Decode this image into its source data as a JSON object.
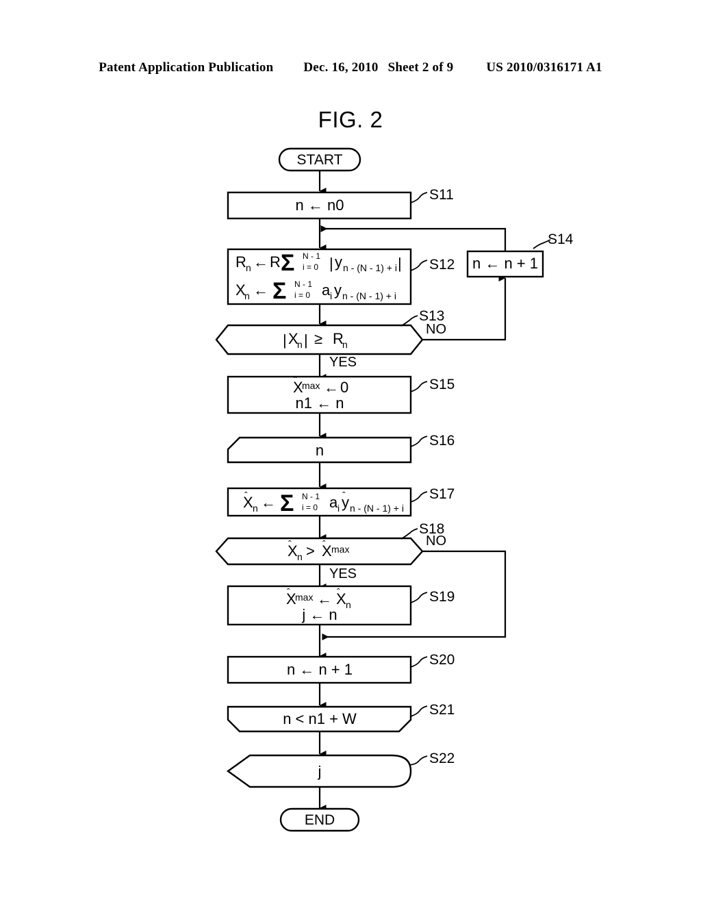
{
  "header": {
    "publication": "Patent Application Publication",
    "date": "Dec. 16, 2010",
    "sheet": "Sheet 2 of 9",
    "number": "US 2010/0316171 A1"
  },
  "figure": {
    "title": "FIG. 2"
  },
  "chart_data": {
    "type": "diagram",
    "diagram_kind": "flowchart",
    "title": "FIG. 2",
    "nodes": [
      {
        "id": "start",
        "shape": "terminator",
        "text": "START",
        "step": ""
      },
      {
        "id": "s11",
        "shape": "process",
        "text": "n ← n0",
        "step": "S11"
      },
      {
        "id": "s12",
        "shape": "process",
        "step": "S12",
        "line1": "Rₙ ← R Σ | yₙ₋₍ₙ₋₁₎₊ᵢ |",
        "line1_parts": {
          "lhs": "R",
          "lhs_sub": "n",
          "arrow": "←",
          "coef": "R",
          "sigma": "Σ",
          "upper": "N - 1",
          "lower": "i = 0",
          "body": "y",
          "body_sub": "n - (N - 1) + i"
        },
        "line2_parts": {
          "lhs": "X",
          "lhs_sub": "n",
          "arrow": "←",
          "sigma": "Σ",
          "upper": "N - 1",
          "lower": "i = 0",
          "coef": "a",
          "coef_sub": "i",
          "body": "y",
          "body_sub": "n - (N - 1) + i"
        }
      },
      {
        "id": "s13",
        "shape": "decision",
        "step": "S13",
        "text_parts": {
          "abs_open": "|",
          "x": "X",
          "x_sub": "n",
          "abs_close": "|",
          "op": "≥",
          "r": "R",
          "r_sub": "n"
        },
        "yes": "YES",
        "no": "NO"
      },
      {
        "id": "s14",
        "shape": "process",
        "text": "n ← n + 1",
        "step": "S14"
      },
      {
        "id": "s15",
        "shape": "process",
        "step": "S15",
        "line1_parts": {
          "x": "X",
          "hat": "ˆ",
          "sup": "max",
          "arrow": "←",
          "value": "0"
        },
        "line2": "n1 ← n"
      },
      {
        "id": "s16",
        "shape": "loop-start",
        "text": "n",
        "step": "S16"
      },
      {
        "id": "s17",
        "shape": "process",
        "step": "S17",
        "text_parts": {
          "lhs": "X",
          "lhs_hat": "ˆ",
          "lhs_sub": "n",
          "arrow": "←",
          "sigma": "Σ",
          "upper": "N - 1",
          "lower": "i = 0",
          "coef": "a",
          "coef_sub": "i",
          "body": "y",
          "body_hat": "ˆ",
          "body_sub": "n - (N - 1) + i"
        }
      },
      {
        "id": "s18",
        "shape": "decision",
        "step": "S18",
        "text_parts": {
          "x1": "X",
          "x1_hat": "ˆ",
          "x1_sub": "n",
          "op": ">",
          "x2": "X",
          "x2_hat": "ˆ",
          "x2_sup": "max"
        },
        "yes": "YES",
        "no": "NO"
      },
      {
        "id": "s19",
        "shape": "process",
        "step": "S19",
        "line1_parts": {
          "lhs": "X",
          "lhs_hat": "ˆ",
          "lhs_sup": "max",
          "arrow": "←",
          "rhs": "X",
          "rhs_hat": "ˆ",
          "rhs_sub": "n"
        },
        "line2": "j ← n"
      },
      {
        "id": "s20",
        "shape": "process",
        "text": "n ← n + 1",
        "step": "S20"
      },
      {
        "id": "s21",
        "shape": "loop-end",
        "text": "n < n1 + W",
        "step": "S21"
      },
      {
        "id": "s22",
        "shape": "display",
        "text": "j",
        "step": "S22"
      },
      {
        "id": "end",
        "shape": "terminator",
        "text": "END",
        "step": ""
      }
    ],
    "edges": [
      {
        "from": "start",
        "to": "s11",
        "label": ""
      },
      {
        "from": "s11",
        "to": "s12",
        "label": ""
      },
      {
        "from": "s12",
        "to": "s13",
        "label": ""
      },
      {
        "from": "s13",
        "to": "s15",
        "label": "YES"
      },
      {
        "from": "s13",
        "to": "s14",
        "label": "NO"
      },
      {
        "from": "s14",
        "to": "s12",
        "label": ""
      },
      {
        "from": "s15",
        "to": "s16",
        "label": ""
      },
      {
        "from": "s16",
        "to": "s17",
        "label": ""
      },
      {
        "from": "s17",
        "to": "s18",
        "label": ""
      },
      {
        "from": "s18",
        "to": "s19",
        "label": "YES"
      },
      {
        "from": "s18",
        "to": "s20",
        "label": "NO"
      },
      {
        "from": "s19",
        "to": "s20",
        "label": ""
      },
      {
        "from": "s20",
        "to": "s21",
        "label": ""
      },
      {
        "from": "s21",
        "to": "s22",
        "label": ""
      },
      {
        "from": "s22",
        "to": "end",
        "label": ""
      }
    ]
  },
  "labels": {
    "start": "START",
    "end": "END",
    "yes": "YES",
    "no": "NO",
    "s11": "S11",
    "s12": "S12",
    "s13": "S13",
    "s14": "S14",
    "s15": "S15",
    "s16": "S16",
    "s17": "S17",
    "s18": "S18",
    "s19": "S19",
    "s20": "S20",
    "s21": "S21",
    "s22": "S22",
    "s11_text": "n ← n0",
    "s14_text": "n ← n + 1",
    "s15_line2": "n1 ← n",
    "s16_text": "n",
    "s19_line2": "j ← n",
    "s20_text": "n ← n + 1",
    "s21_text": "n < n1 + W",
    "s22_text": "j",
    "sigma": "Σ",
    "sum_upper": "N - 1",
    "sum_lower": "i = 0",
    "sub_index": "n - (N - 1) + i",
    "sup_max": "max",
    "hat": "ˆ",
    "arrow": "←",
    "ge": "≥",
    "gt": ">",
    "bar": "|",
    "letter_R": "R",
    "letter_X": "X",
    "letter_y": "y",
    "letter_a": "a",
    "letter_n": "n",
    "letter_i": "i",
    "zero": "0"
  }
}
